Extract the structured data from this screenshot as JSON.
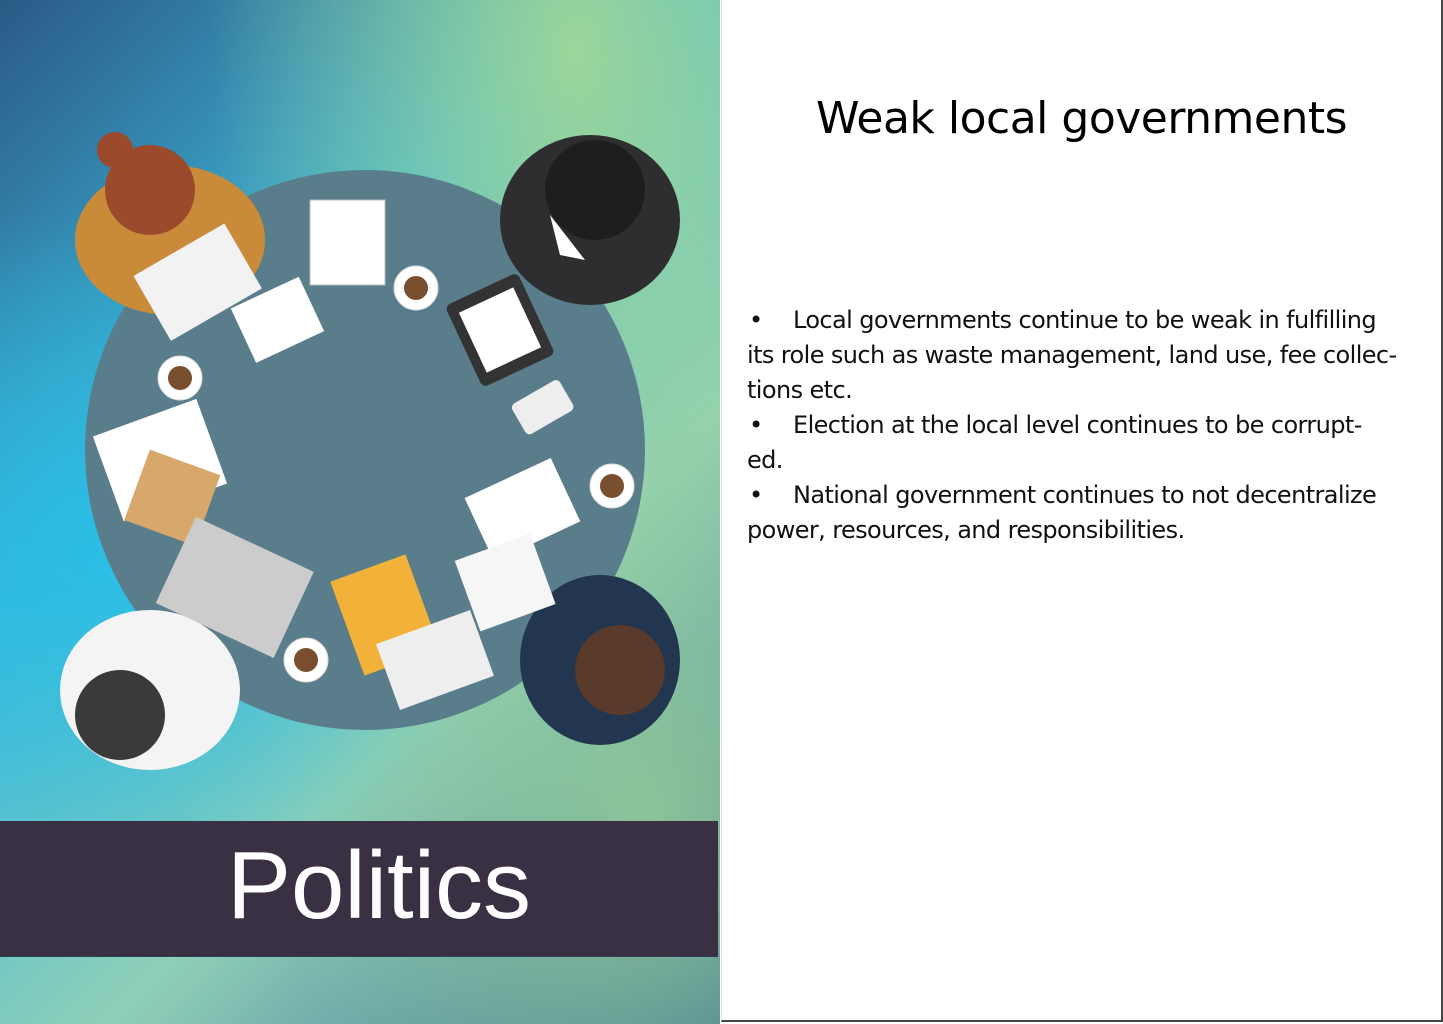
{
  "left_panel": {
    "banner_title": "Politics"
  },
  "right_panel": {
    "title": "Weak local governments",
    "bullets": [
      {
        "marker": "•",
        "lines": [
          "Local governments continue to be weak in fulfilling",
          "its role such as waste management, land use, fee collec-",
          "tions etc."
        ]
      },
      {
        "marker": "•",
        "lines": [
          "Election at the local level continues to be corrupt-",
          "ed."
        ]
      },
      {
        "marker": "•",
        "lines": [
          "National government continues to not decentralize",
          "power, resources, and responsibilities."
        ]
      }
    ]
  },
  "colors": {
    "banner": "#3a3044",
    "table": "#5a7d8c"
  }
}
